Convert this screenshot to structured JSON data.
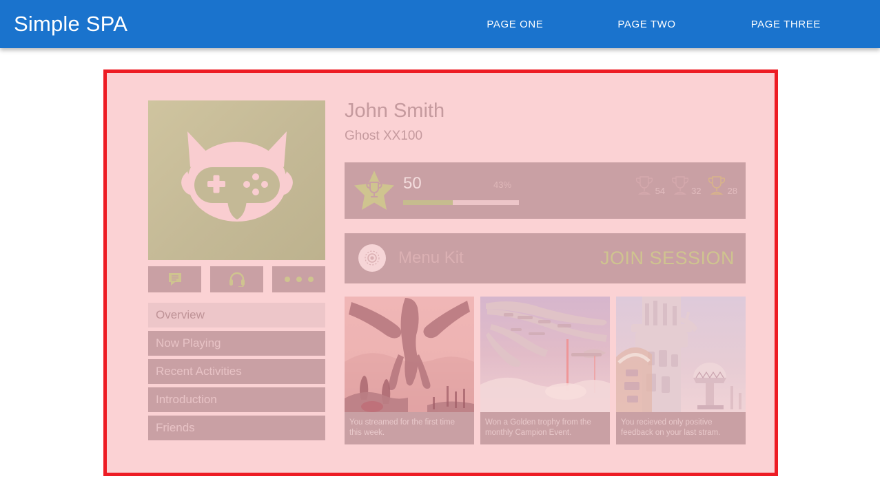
{
  "header": {
    "brand": "Simple SPA",
    "nav": [
      {
        "label": "PAGE ONE"
      },
      {
        "label": "PAGE TWO"
      },
      {
        "label": "PAGE THREE"
      }
    ],
    "background_color": "#1a73cd",
    "text_color": "#ffffff"
  },
  "selection": {
    "border_color": "#ed1c24",
    "overlay_color": "#fbd2d4"
  },
  "profile": {
    "avatar_icon": "cat-gamepad-avatar-icon",
    "name": "John Smith",
    "tag": "Ghost XX100",
    "actions": [
      {
        "name": "chat",
        "icon": "chat-bubble-icon"
      },
      {
        "name": "voice",
        "icon": "headset-icon"
      },
      {
        "name": "more",
        "icon": "more-dots-icon"
      }
    ]
  },
  "sidebar": {
    "items": [
      {
        "label": "Overview",
        "active": true
      },
      {
        "label": "Now Playing",
        "active": false
      },
      {
        "label": "Recent Activities",
        "active": false
      },
      {
        "label": "Introduction",
        "active": false
      },
      {
        "label": "Friends",
        "active": false
      }
    ]
  },
  "stats": {
    "level_icon": "star-trophy-icon",
    "level": "50",
    "progress_percent_label": "43%",
    "progress_percent": 43,
    "trophies": [
      {
        "icon": "trophy-icon",
        "count": "54",
        "tier": "silver"
      },
      {
        "icon": "trophy-icon",
        "count": "32",
        "tier": "silver"
      },
      {
        "icon": "trophy-icon",
        "count": "28",
        "tier": "gold"
      }
    ]
  },
  "session": {
    "icon": "record-target-icon",
    "title": "Menu Kit",
    "join_label": "JOIN SESSION",
    "join_color": "#cfc48f"
  },
  "activities": [
    {
      "image": "alien-creature-landscape",
      "caption": "You streamed for the first time this week."
    },
    {
      "image": "spaceship-beams",
      "caption": "Won a Golden trophy from the monthly Campion Event."
    },
    {
      "image": "futuristic-tower-observatory",
      "caption": "You recieved only positive feedback on your last stram."
    }
  ]
}
